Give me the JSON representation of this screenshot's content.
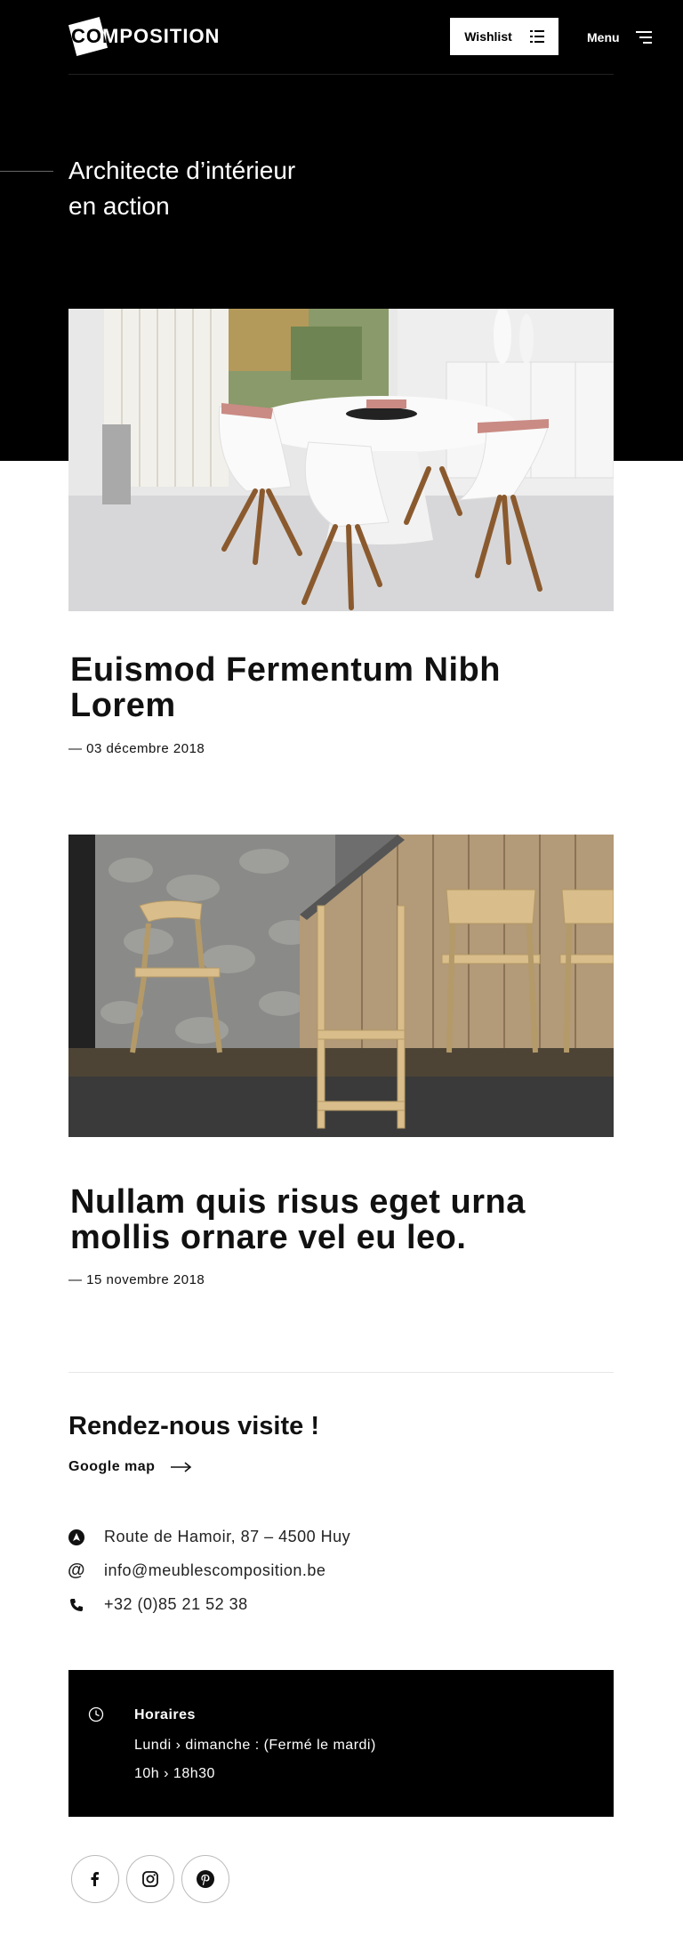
{
  "header": {
    "logo_text": "COMPOSITION",
    "wishlist_label": "Wishlist",
    "menu_label": "Menu"
  },
  "hero": {
    "title_line1": "Architecte d’intérieur",
    "title_line2": "en action"
  },
  "articles": [
    {
      "title": "Euismod Fermentum Nibh Lorem",
      "date": "— 03 décembre 2018"
    },
    {
      "title": "Nullam quis risus eget urna mollis ornare vel eu leo.",
      "date": "— 15 novembre 2018"
    }
  ],
  "contact": {
    "title": "Rendez-nous visite !",
    "map_link": "Google map",
    "address": "Route de Hamoir, 87 – 4500 Huy",
    "email": "info@meublescomposition.be",
    "phone": "+32 (0)85 21 52 38"
  },
  "hours": {
    "title": "Horaires",
    "days": "Lundi › dimanche :  (Fermé le mardi)",
    "time": "10h › 18h30"
  },
  "social": [
    "facebook-icon",
    "instagram-icon",
    "pinterest-icon"
  ],
  "colors": {
    "hero_bg": "#000000",
    "text": "#111111",
    "divider": "#e6e6e6"
  }
}
